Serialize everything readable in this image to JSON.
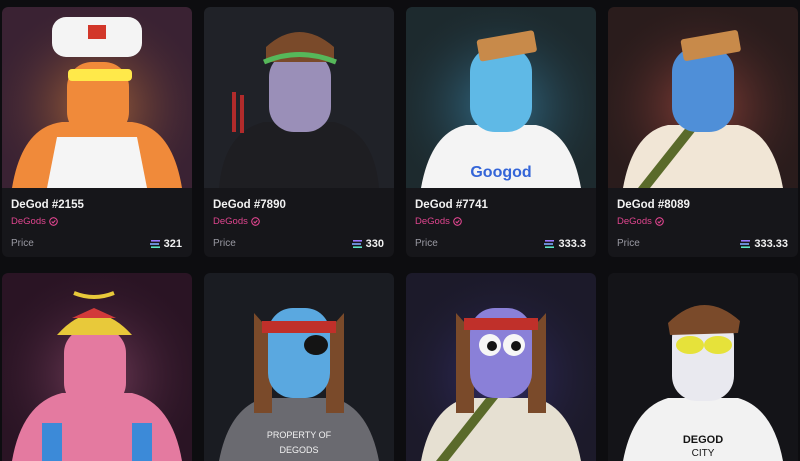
{
  "cards": [
    {
      "title": "DeGod #2155",
      "collection": "DeGods",
      "price_label": "Price",
      "price": "321",
      "bg": "#3a2233",
      "skin": "#f08a3a",
      "glow": "#ff9a3c"
    },
    {
      "title": "DeGod #7890",
      "collection": "DeGods",
      "price_label": "Price",
      "price": "330",
      "bg": "#202228",
      "skin": "#9a8fb8",
      "glow": "#3a3a44"
    },
    {
      "title": "DeGod #7741",
      "collection": "DeGods",
      "price_label": "Price",
      "price": "333.3",
      "bg": "#1d2a2e",
      "skin": "#5fb9e6",
      "glow": "#4cc3ff"
    },
    {
      "title": "DeGod #8089",
      "collection": "DeGods",
      "price_label": "Price",
      "price": "333.33",
      "bg": "#2a1c1c",
      "skin": "#4f8fd8",
      "glow": "#ff6a5a"
    },
    {
      "skin": "#e47aa0",
      "bg": "#2a1424",
      "glow": "#ff8ac0"
    },
    {
      "skin": "#5aa8e0",
      "bg": "#1a1c22",
      "glow": "#2e3440"
    },
    {
      "skin": "#8a80d8",
      "bg": "#1c1a2a",
      "glow": "#6a5aff"
    },
    {
      "skin": "#e9e9ef",
      "bg": "#141418",
      "glow": "#5a5a6a"
    }
  ],
  "icons": {
    "verified": "verified-check-icon",
    "currency": "sol-icon"
  },
  "colors": {
    "collection": "#e0458f",
    "background": "#0d0d10"
  }
}
